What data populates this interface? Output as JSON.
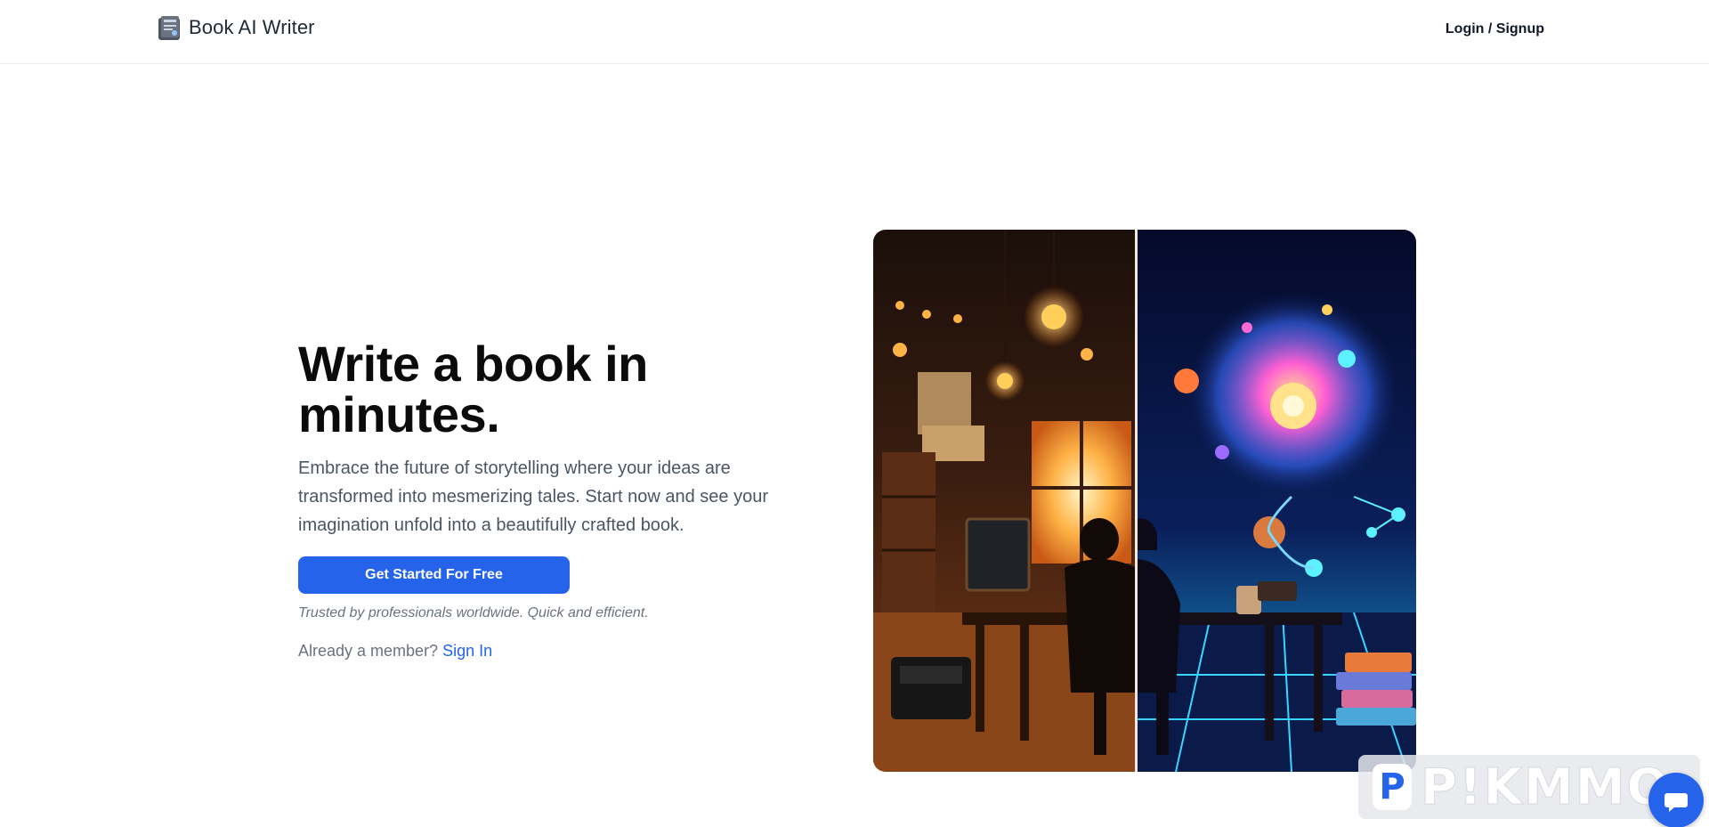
{
  "header": {
    "brand_name": "Book AI Writer",
    "login_label": "Login / Signup"
  },
  "hero": {
    "headline": "Write a book in minutes.",
    "subtext": "Embrace the future of storytelling where your ideas are transformed into mesmerizing tales. Start now and see your imagination unfold into a beautifully crafted book.",
    "cta_label": "Get Started For Free",
    "trust_text": "Trusted by professionals worldwide. Quick and efficient.",
    "member_prompt": "Already a member?",
    "signin_label": "Sign In"
  },
  "watermark": {
    "icon_letter": "P",
    "text": "P!KMMO"
  },
  "icons": [
    "book-logo-icon",
    "chat-icon"
  ],
  "colors": {
    "accent": "#2563eb",
    "headline": "#0b0b0b",
    "body_text": "#4b5563",
    "muted_text": "#6b7280"
  }
}
